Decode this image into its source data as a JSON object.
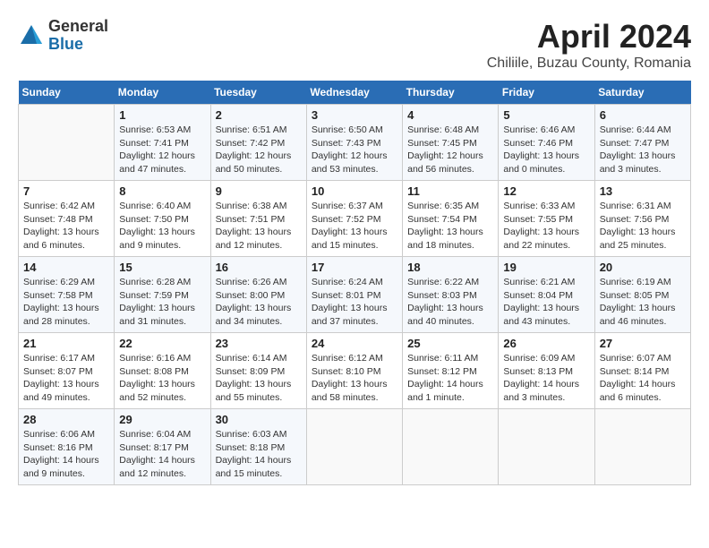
{
  "logo": {
    "line1": "General",
    "line2": "Blue"
  },
  "title": "April 2024",
  "subtitle": "Chiliile, Buzau County, Romania",
  "days_of_week": [
    "Sunday",
    "Monday",
    "Tuesday",
    "Wednesday",
    "Thursday",
    "Friday",
    "Saturday"
  ],
  "weeks": [
    [
      {
        "day": "",
        "sunrise": "",
        "sunset": "",
        "daylight": ""
      },
      {
        "day": "1",
        "sunrise": "6:53 AM",
        "sunset": "7:41 PM",
        "daylight": "12 hours and 47 minutes."
      },
      {
        "day": "2",
        "sunrise": "6:51 AM",
        "sunset": "7:42 PM",
        "daylight": "12 hours and 50 minutes."
      },
      {
        "day": "3",
        "sunrise": "6:50 AM",
        "sunset": "7:43 PM",
        "daylight": "12 hours and 53 minutes."
      },
      {
        "day": "4",
        "sunrise": "6:48 AM",
        "sunset": "7:45 PM",
        "daylight": "12 hours and 56 minutes."
      },
      {
        "day": "5",
        "sunrise": "6:46 AM",
        "sunset": "7:46 PM",
        "daylight": "13 hours and 0 minutes."
      },
      {
        "day": "6",
        "sunrise": "6:44 AM",
        "sunset": "7:47 PM",
        "daylight": "13 hours and 3 minutes."
      }
    ],
    [
      {
        "day": "7",
        "sunrise": "6:42 AM",
        "sunset": "7:48 PM",
        "daylight": "13 hours and 6 minutes."
      },
      {
        "day": "8",
        "sunrise": "6:40 AM",
        "sunset": "7:50 PM",
        "daylight": "13 hours and 9 minutes."
      },
      {
        "day": "9",
        "sunrise": "6:38 AM",
        "sunset": "7:51 PM",
        "daylight": "13 hours and 12 minutes."
      },
      {
        "day": "10",
        "sunrise": "6:37 AM",
        "sunset": "7:52 PM",
        "daylight": "13 hours and 15 minutes."
      },
      {
        "day": "11",
        "sunrise": "6:35 AM",
        "sunset": "7:54 PM",
        "daylight": "13 hours and 18 minutes."
      },
      {
        "day": "12",
        "sunrise": "6:33 AM",
        "sunset": "7:55 PM",
        "daylight": "13 hours and 22 minutes."
      },
      {
        "day": "13",
        "sunrise": "6:31 AM",
        "sunset": "7:56 PM",
        "daylight": "13 hours and 25 minutes."
      }
    ],
    [
      {
        "day": "14",
        "sunrise": "6:29 AM",
        "sunset": "7:58 PM",
        "daylight": "13 hours and 28 minutes."
      },
      {
        "day": "15",
        "sunrise": "6:28 AM",
        "sunset": "7:59 PM",
        "daylight": "13 hours and 31 minutes."
      },
      {
        "day": "16",
        "sunrise": "6:26 AM",
        "sunset": "8:00 PM",
        "daylight": "13 hours and 34 minutes."
      },
      {
        "day": "17",
        "sunrise": "6:24 AM",
        "sunset": "8:01 PM",
        "daylight": "13 hours and 37 minutes."
      },
      {
        "day": "18",
        "sunrise": "6:22 AM",
        "sunset": "8:03 PM",
        "daylight": "13 hours and 40 minutes."
      },
      {
        "day": "19",
        "sunrise": "6:21 AM",
        "sunset": "8:04 PM",
        "daylight": "13 hours and 43 minutes."
      },
      {
        "day": "20",
        "sunrise": "6:19 AM",
        "sunset": "8:05 PM",
        "daylight": "13 hours and 46 minutes."
      }
    ],
    [
      {
        "day": "21",
        "sunrise": "6:17 AM",
        "sunset": "8:07 PM",
        "daylight": "13 hours and 49 minutes."
      },
      {
        "day": "22",
        "sunrise": "6:16 AM",
        "sunset": "8:08 PM",
        "daylight": "13 hours and 52 minutes."
      },
      {
        "day": "23",
        "sunrise": "6:14 AM",
        "sunset": "8:09 PM",
        "daylight": "13 hours and 55 minutes."
      },
      {
        "day": "24",
        "sunrise": "6:12 AM",
        "sunset": "8:10 PM",
        "daylight": "13 hours and 58 minutes."
      },
      {
        "day": "25",
        "sunrise": "6:11 AM",
        "sunset": "8:12 PM",
        "daylight": "14 hours and 1 minute."
      },
      {
        "day": "26",
        "sunrise": "6:09 AM",
        "sunset": "8:13 PM",
        "daylight": "14 hours and 3 minutes."
      },
      {
        "day": "27",
        "sunrise": "6:07 AM",
        "sunset": "8:14 PM",
        "daylight": "14 hours and 6 minutes."
      }
    ],
    [
      {
        "day": "28",
        "sunrise": "6:06 AM",
        "sunset": "8:16 PM",
        "daylight": "14 hours and 9 minutes."
      },
      {
        "day": "29",
        "sunrise": "6:04 AM",
        "sunset": "8:17 PM",
        "daylight": "14 hours and 12 minutes."
      },
      {
        "day": "30",
        "sunrise": "6:03 AM",
        "sunset": "8:18 PM",
        "daylight": "14 hours and 15 minutes."
      },
      {
        "day": "",
        "sunrise": "",
        "sunset": "",
        "daylight": ""
      },
      {
        "day": "",
        "sunrise": "",
        "sunset": "",
        "daylight": ""
      },
      {
        "day": "",
        "sunrise": "",
        "sunset": "",
        "daylight": ""
      },
      {
        "day": "",
        "sunrise": "",
        "sunset": "",
        "daylight": ""
      }
    ]
  ],
  "labels": {
    "sunrise": "Sunrise:",
    "sunset": "Sunset:",
    "daylight": "Daylight:"
  }
}
